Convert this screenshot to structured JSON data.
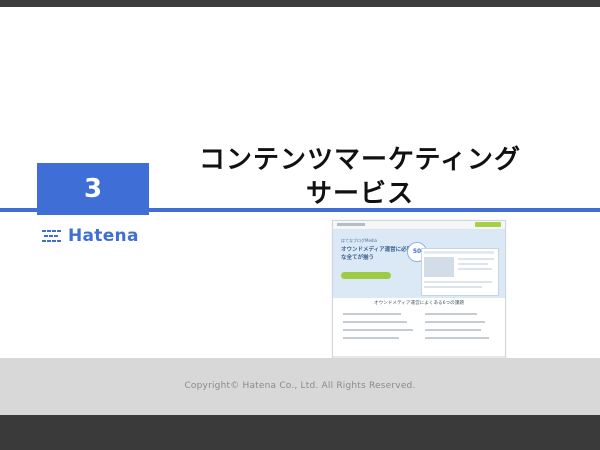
{
  "slide": {
    "section_number": "3",
    "title_line1": "コンテンツマーケティング",
    "title_line2": "サービス",
    "logo_text": "Hatena",
    "copyright": "Copyright©  Hatena Co., Ltd.   All Rights Reserved."
  },
  "thumbnail": {
    "hero_subtitle": "はてなブログMedia",
    "hero_headline": "オウンドメディア運営に必要な全てが揃う",
    "hero_badge": "50",
    "hero_button": "",
    "section_heading": "オウンドメディア運営によくある6つの課題"
  },
  "colors": {
    "accent": "#3f6fd6",
    "footer_band": "#d8d8d8",
    "frame_dark": "#3a3a3a",
    "thumb_hero": "#dbe8f6",
    "thumb_button": "#9dcc44"
  }
}
